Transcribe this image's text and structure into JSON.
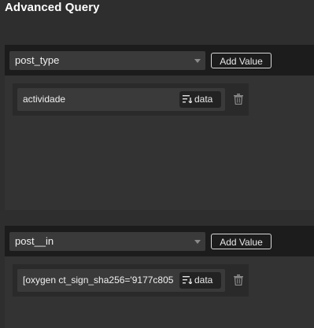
{
  "header": {
    "title": "Advanced Query"
  },
  "queries": [
    {
      "param": "post_type",
      "add_label": "Add Value",
      "values": [
        {
          "text": "actividade",
          "data_label": "data"
        }
      ]
    },
    {
      "param": "post__in",
      "add_label": "Add Value",
      "values": [
        {
          "text": "[oxygen ct_sign_sha256='9177c805",
          "data_label": "data"
        }
      ]
    }
  ],
  "icons": {
    "select_caret": "chevron-down-icon",
    "data_icon": "sort-lines-icon",
    "delete_icon": "trash-icon"
  },
  "colors": {
    "background": "#2e2e2e",
    "header": "#1c1c1c",
    "body": "#333333",
    "input": "#3a3a3a"
  }
}
